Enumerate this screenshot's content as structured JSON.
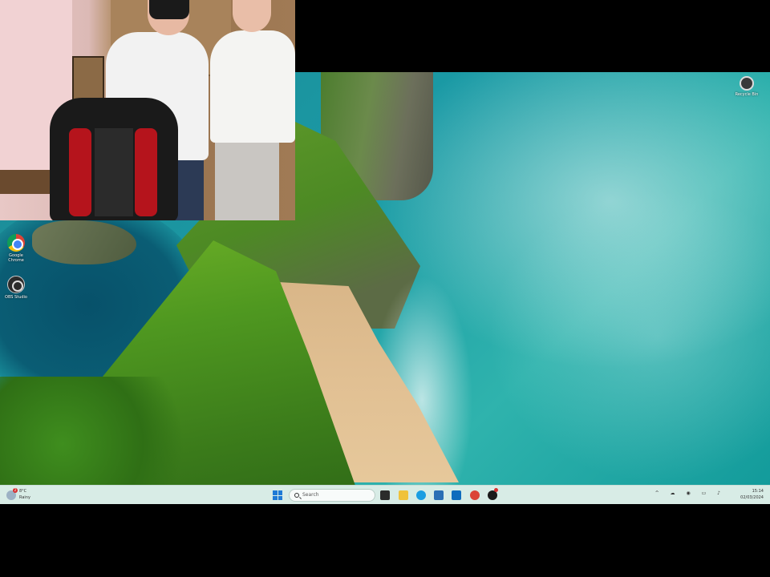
{
  "webcam": {
    "label": "webcam overlay"
  },
  "desktop_icons": [
    {
      "label": "Google Chrome",
      "icon": "chrome-icon"
    },
    {
      "label": "OBS Studio",
      "icon": "obs-icon"
    }
  ],
  "recycle_bin": {
    "label": "Recycle Bin",
    "icon": "recycle-bin-icon"
  },
  "taskbar": {
    "weather": {
      "temp": "8°C",
      "desc": "Rainy",
      "badge": "2"
    },
    "search": {
      "placeholder": "Search"
    },
    "apps": [
      {
        "name": "task-view",
        "color": "#2b2b2b"
      },
      {
        "name": "file-explorer",
        "color": "#f0c23b"
      },
      {
        "name": "edge",
        "color": "#1b9de2"
      },
      {
        "name": "microsoft-store",
        "color": "#2a6fb5"
      },
      {
        "name": "outlook",
        "color": "#0f6cbd"
      },
      {
        "name": "chrome",
        "color": "#db4437"
      },
      {
        "name": "obs",
        "color": "#1a1a1a"
      }
    ],
    "tray": "^ ☁ ◉ ▭ ♪",
    "clock": {
      "time": "15:14",
      "date": "02/03/2024"
    }
  }
}
